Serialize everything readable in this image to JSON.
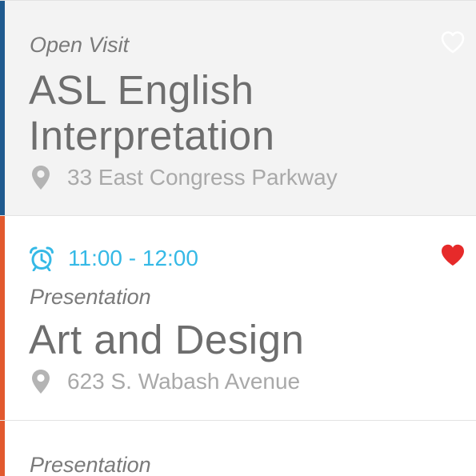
{
  "colors": {
    "stripe_blue": "#1f5a8f",
    "stripe_orange": "#e2592e",
    "time_text": "#35b9e6",
    "heart_red": "#e62a2a",
    "heart_outline": "#ffffff"
  },
  "events": [
    {
      "type": "Open Visit",
      "title_line1": "ASL English",
      "title_line2": "Interpretation",
      "address": "33 East Congress Parkway",
      "favorite": false,
      "heart_icon": "heart-outline-icon",
      "location_icon": "map-pin-icon"
    },
    {
      "time": "11:00 - 12:00",
      "time_icon": "alarm-clock-icon",
      "type": "Presentation",
      "title_line1": "Art and Design",
      "address": "623 S. Wabash Avenue",
      "favorite": true,
      "heart_icon": "heart-filled-icon",
      "location_icon": "map-pin-icon"
    },
    {
      "type": "Presentation"
    }
  ]
}
